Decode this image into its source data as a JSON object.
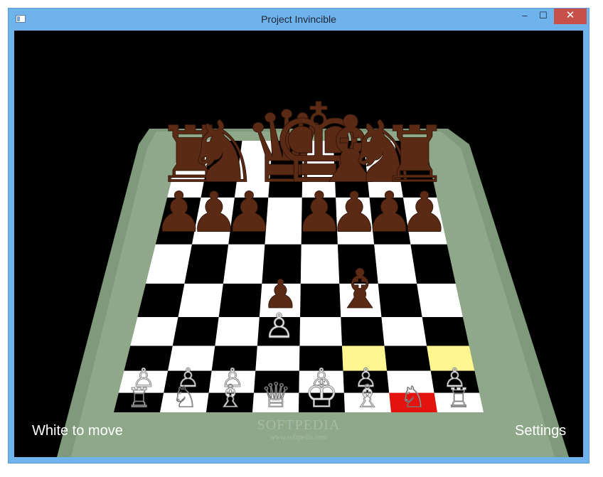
{
  "window": {
    "title": "Project Invincible",
    "controls": {
      "minimize": "‒",
      "maximize": "☐",
      "close": "✕"
    }
  },
  "hud": {
    "status": "White to move",
    "settings": "Settings"
  },
  "watermark": {
    "main": "SOFTPEDIA",
    "sub": "www.softpedia.com"
  },
  "colors": {
    "light_square": "#ffffff",
    "dark_square": "#000000",
    "highlight_move": "#fff68f",
    "highlight_selected": "#e31410",
    "board_frame": "#8fa88a",
    "dark_piece": "#5a2a14",
    "light_piece": "#e8e8e8"
  },
  "board": {
    "files": [
      "a",
      "b",
      "c",
      "d",
      "e",
      "f",
      "g",
      "h"
    ],
    "ranks": [
      "8",
      "7",
      "6",
      "5",
      "4",
      "3",
      "2",
      "1"
    ],
    "highlights": [
      {
        "square": "f3",
        "kind": "move"
      },
      {
        "square": "h3",
        "kind": "move"
      },
      {
        "square": "g1",
        "kind": "selected"
      }
    ],
    "pieces": [
      {
        "square": "a8",
        "color": "black",
        "type": "rook"
      },
      {
        "square": "b8",
        "color": "black",
        "type": "knight"
      },
      {
        "square": "d8",
        "color": "black",
        "type": "queen"
      },
      {
        "square": "e8",
        "color": "black",
        "type": "king"
      },
      {
        "square": "f8",
        "color": "black",
        "type": "bishop"
      },
      {
        "square": "g8",
        "color": "black",
        "type": "knight"
      },
      {
        "square": "h8",
        "color": "black",
        "type": "rook"
      },
      {
        "square": "a7",
        "color": "black",
        "type": "pawn"
      },
      {
        "square": "b7",
        "color": "black",
        "type": "pawn"
      },
      {
        "square": "c7",
        "color": "black",
        "type": "pawn"
      },
      {
        "square": "e7",
        "color": "black",
        "type": "pawn"
      },
      {
        "square": "f7",
        "color": "black",
        "type": "pawn"
      },
      {
        "square": "g7",
        "color": "black",
        "type": "pawn"
      },
      {
        "square": "h7",
        "color": "black",
        "type": "pawn"
      },
      {
        "square": "d5",
        "color": "black",
        "type": "pawn"
      },
      {
        "square": "f5",
        "color": "black",
        "type": "bishop"
      },
      {
        "square": "d4",
        "color": "white",
        "type": "pawn"
      },
      {
        "square": "a2",
        "color": "white",
        "type": "pawn"
      },
      {
        "square": "b2",
        "color": "white",
        "type": "pawn"
      },
      {
        "square": "c2",
        "color": "white",
        "type": "pawn"
      },
      {
        "square": "e2",
        "color": "white",
        "type": "pawn"
      },
      {
        "square": "f2",
        "color": "white",
        "type": "pawn"
      },
      {
        "square": "h2",
        "color": "white",
        "type": "pawn"
      },
      {
        "square": "a1",
        "color": "white",
        "type": "rook"
      },
      {
        "square": "b1",
        "color": "white",
        "type": "knight"
      },
      {
        "square": "c1",
        "color": "white",
        "type": "bishop"
      },
      {
        "square": "d1",
        "color": "white",
        "type": "queen"
      },
      {
        "square": "e1",
        "color": "white",
        "type": "king"
      },
      {
        "square": "f1",
        "color": "white",
        "type": "bishop"
      },
      {
        "square": "g1",
        "color": "white",
        "type": "knight"
      },
      {
        "square": "h1",
        "color": "white",
        "type": "rook"
      }
    ]
  }
}
